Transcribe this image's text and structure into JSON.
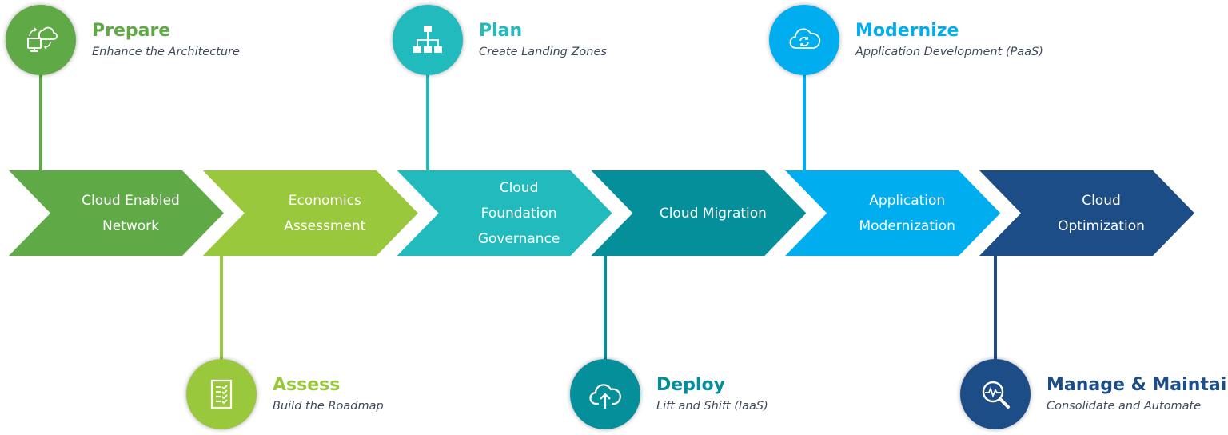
{
  "colors": {
    "green": "#5fa946",
    "lime": "#9ac83c",
    "turquoise": "#22bbbd",
    "teal": "#048f9b",
    "sky": "#00aeef",
    "navy": "#1c4d86",
    "subtitle": "#3f4a5c"
  },
  "stages": [
    {
      "lines": [
        "Cloud Enabled",
        "Network"
      ],
      "color": "#5fa946"
    },
    {
      "lines": [
        "Economics",
        "Assessment"
      ],
      "color": "#9ac83c"
    },
    {
      "lines": [
        "Cloud",
        "Foundation",
        "Governance"
      ],
      "color": "#22bbbd"
    },
    {
      "lines": [
        "Cloud Migration"
      ],
      "color": "#048f9b"
    },
    {
      "lines": [
        "Application",
        "Modernization"
      ],
      "color": "#00aeef"
    },
    {
      "lines": [
        "Cloud",
        "Optimization"
      ],
      "color": "#1c4d86"
    }
  ],
  "phases": [
    {
      "title": "Prepare",
      "subtitle": "Enhance the Architecture",
      "icon": "cloud-sync-monitor-icon",
      "position": "top",
      "stage": 0
    },
    {
      "title": "Assess",
      "subtitle": "Build the Roadmap",
      "icon": "checklist-icon",
      "position": "bottom",
      "stage": 1
    },
    {
      "title": "Plan",
      "subtitle": "Create Landing Zones",
      "icon": "hierarchy-icon",
      "position": "top",
      "stage": 2
    },
    {
      "title": "Deploy",
      "subtitle": "Lift and Shift (IaaS)",
      "icon": "cloud-upload-icon",
      "position": "bottom",
      "stage": 3
    },
    {
      "title": "Modernize",
      "subtitle": "Application Development (PaaS)",
      "icon": "cloud-refresh-icon",
      "position": "top",
      "stage": 4
    },
    {
      "title": "Manage & Maintain",
      "subtitle": "Consolidate and Automate",
      "icon": "magnify-pulse-icon",
      "position": "bottom",
      "stage": 5
    }
  ]
}
